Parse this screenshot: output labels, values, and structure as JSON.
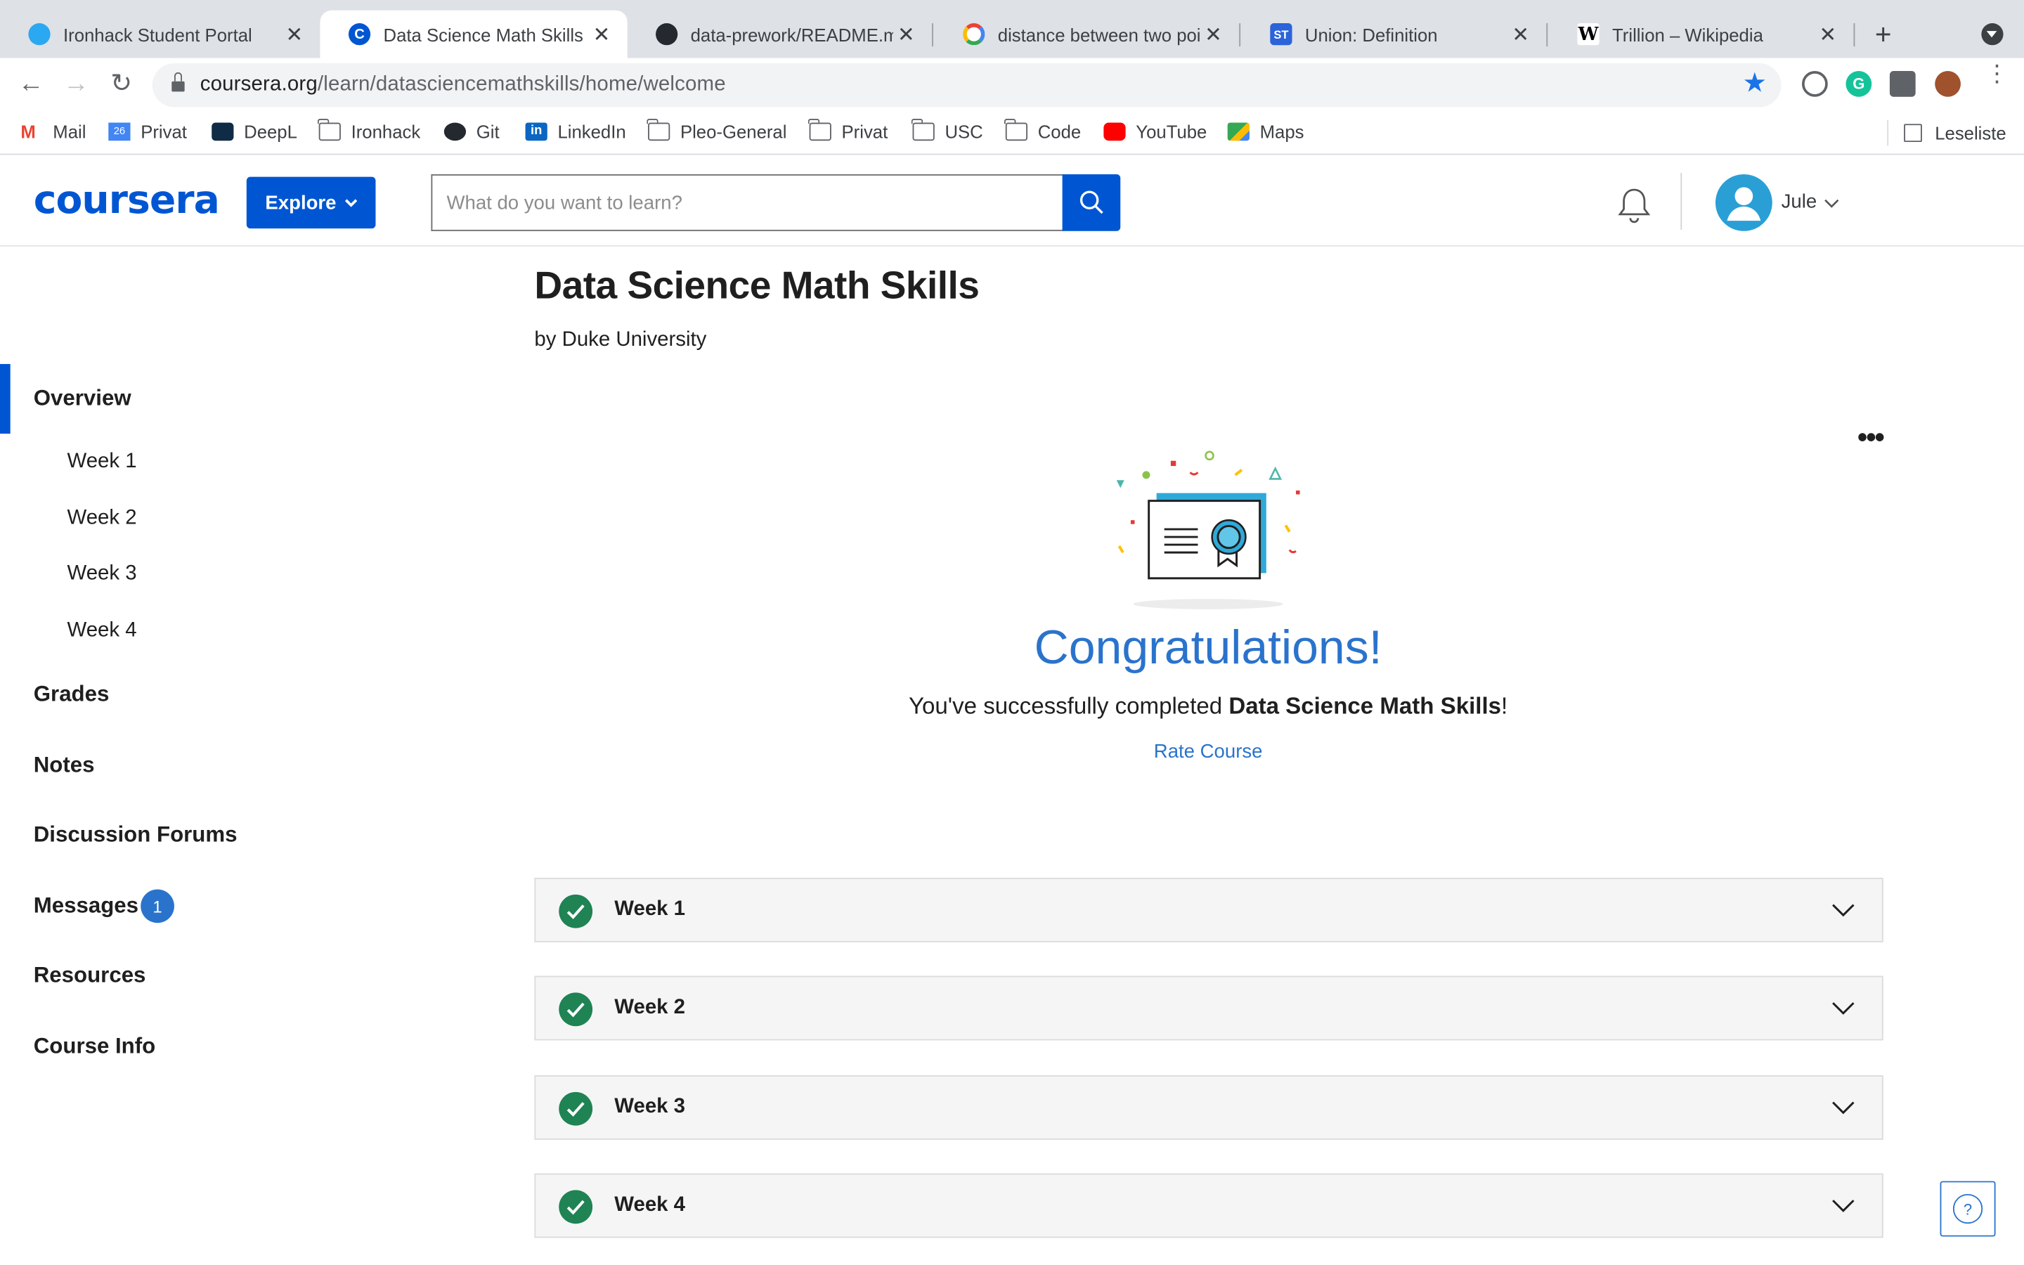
{
  "browser": {
    "tabs": [
      {
        "title": "Ironhack Student Portal",
        "active": false,
        "icon": "ironhack-icon"
      },
      {
        "title": "Data Science Math Skills - C",
        "active": true,
        "icon": "coursera-icon"
      },
      {
        "title": "data-prework/README.md",
        "active": false,
        "icon": "github-icon"
      },
      {
        "title": "distance between two point",
        "active": false,
        "icon": "google-icon"
      },
      {
        "title": "Union: Definition",
        "active": false,
        "icon": "st-icon"
      },
      {
        "title": "Trillion – Wikipedia",
        "active": false,
        "icon": "wikipedia-icon"
      }
    ],
    "url_host": "coursera.org",
    "url_path": "/learn/datasciencemathskills/home/welcome",
    "bookmarks": [
      "Mail",
      "Privat",
      "DeepL",
      "Ironhack",
      "Git",
      "LinkedIn",
      "Pleo-General",
      "Privat",
      "USC",
      "Code",
      "YouTube",
      "Maps"
    ],
    "reading_list": "Leseliste",
    "accent_color": "#1a73e8"
  },
  "header": {
    "logo": "coursera",
    "explore_label": "Explore",
    "search_placeholder": "What do you want to learn?",
    "username": "Jule",
    "brand_color": "#0056d2"
  },
  "sidebar": {
    "items": [
      {
        "label": "Overview",
        "active": true
      },
      {
        "label": "Week 1"
      },
      {
        "label": "Week 2"
      },
      {
        "label": "Week 3"
      },
      {
        "label": "Week 4"
      },
      {
        "label": "Grades"
      },
      {
        "label": "Notes"
      },
      {
        "label": "Discussion Forums"
      },
      {
        "label": "Messages",
        "badge": "1"
      },
      {
        "label": "Resources"
      },
      {
        "label": "Course Info"
      }
    ]
  },
  "main": {
    "course_title": "Data Science Math Skills",
    "course_by": "by Duke University",
    "congrats": "Congratulations!",
    "completed_prefix": "You've successfully completed ",
    "completed_course": "Data Science Math Skills",
    "completed_suffix": "!",
    "rate_label": "Rate Course",
    "weeks": [
      {
        "label": "Week 1",
        "completed": true
      },
      {
        "label": "Week 2",
        "completed": true
      },
      {
        "label": "Week 3",
        "completed": true
      },
      {
        "label": "Week 4",
        "completed": true
      }
    ],
    "success_color": "#1f8354",
    "help_label": "?"
  }
}
